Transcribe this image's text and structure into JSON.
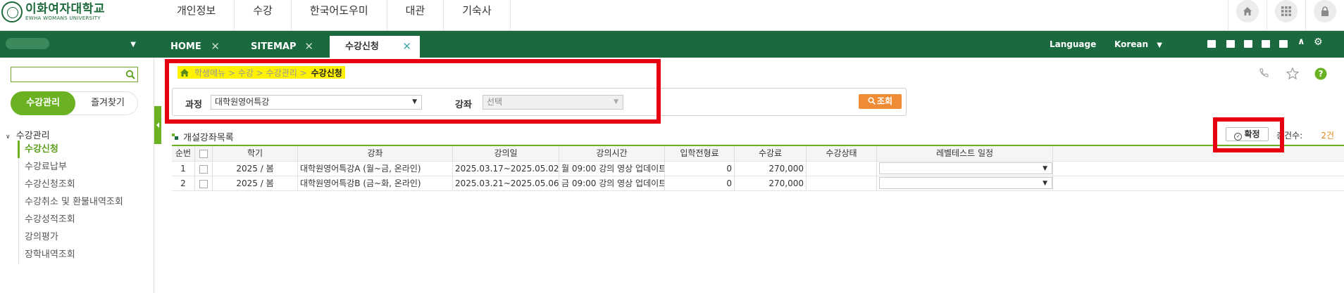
{
  "header": {
    "logo_kr": "이화여자대학교",
    "logo_en": "EWHA WOMANS UNIVERSITY",
    "gnb": [
      "개인정보",
      "수강",
      "한국어도우미",
      "대관",
      "기숙사"
    ],
    "icons": [
      "home-icon",
      "apps-grid-icon",
      "lock-icon"
    ]
  },
  "tabbar": {
    "tabs": [
      {
        "label": "HOME"
      },
      {
        "label": "SITEMAP"
      },
      {
        "label": "수강신청"
      }
    ],
    "close_glyph": "✕",
    "language_label": "Language",
    "language_value": "Korean",
    "window_icons": [
      "tile-icon",
      "layout-icon",
      "expand-icon",
      "minimize-icon",
      "fit-icon",
      "collapse-up-icon",
      "settings-icon"
    ]
  },
  "sidebar": {
    "search_placeholder": "",
    "pill_active": "수강관리",
    "pill_inactive": "즐겨찾기",
    "tree_title": "수강관리",
    "items": [
      "수강신청",
      "수강료납부",
      "수강신청조회",
      "수강취소 및 환불내역조회",
      "수강성적조회",
      "강의평가",
      "장학내역조회"
    ],
    "active_index": 0
  },
  "breadcrumb": {
    "path": "학생메뉴 > 수강 > 수강관리 >",
    "current": "수강신청"
  },
  "filter": {
    "course_label": "과정",
    "course_value": "대학원영어특강",
    "class_label": "강좌",
    "class_value": "선택",
    "search_button": "조회"
  },
  "list": {
    "title": "개설강좌목록",
    "confirm_button": "확정",
    "total_label": "총건수:",
    "total_value": "2건",
    "columns": [
      "순번",
      "",
      "학기",
      "강좌",
      "강의일",
      "강의시간",
      "입학전형료",
      "수강료",
      "수강상태",
      "레벨테스트 일정"
    ],
    "rows": [
      {
        "no": "1",
        "term": "2025 / 봄",
        "course": "대학원영어특강A (월~금, 온라인)",
        "dates": "2025.03.17~2025.05.02",
        "time": "월 09:00 강의 영상 업데이트",
        "fee_entry": "0",
        "tuition": "270,000",
        "status": "",
        "level_test": ""
      },
      {
        "no": "2",
        "term": "2025 / 봄",
        "course": "대학원영어특강B (금~화, 온라인)",
        "dates": "2025.03.21~2025.05.06",
        "time": "금 09:00 강의 영상 업데이트",
        "fee_entry": "0",
        "tuition": "270,000",
        "status": "",
        "level_test": ""
      }
    ]
  },
  "colors": {
    "brand_green": "#1b6a3f",
    "accent_green": "#6ab221",
    "highlight_yellow": "#fff200",
    "annotation_red": "#e60012",
    "search_orange": "#f08b35"
  }
}
